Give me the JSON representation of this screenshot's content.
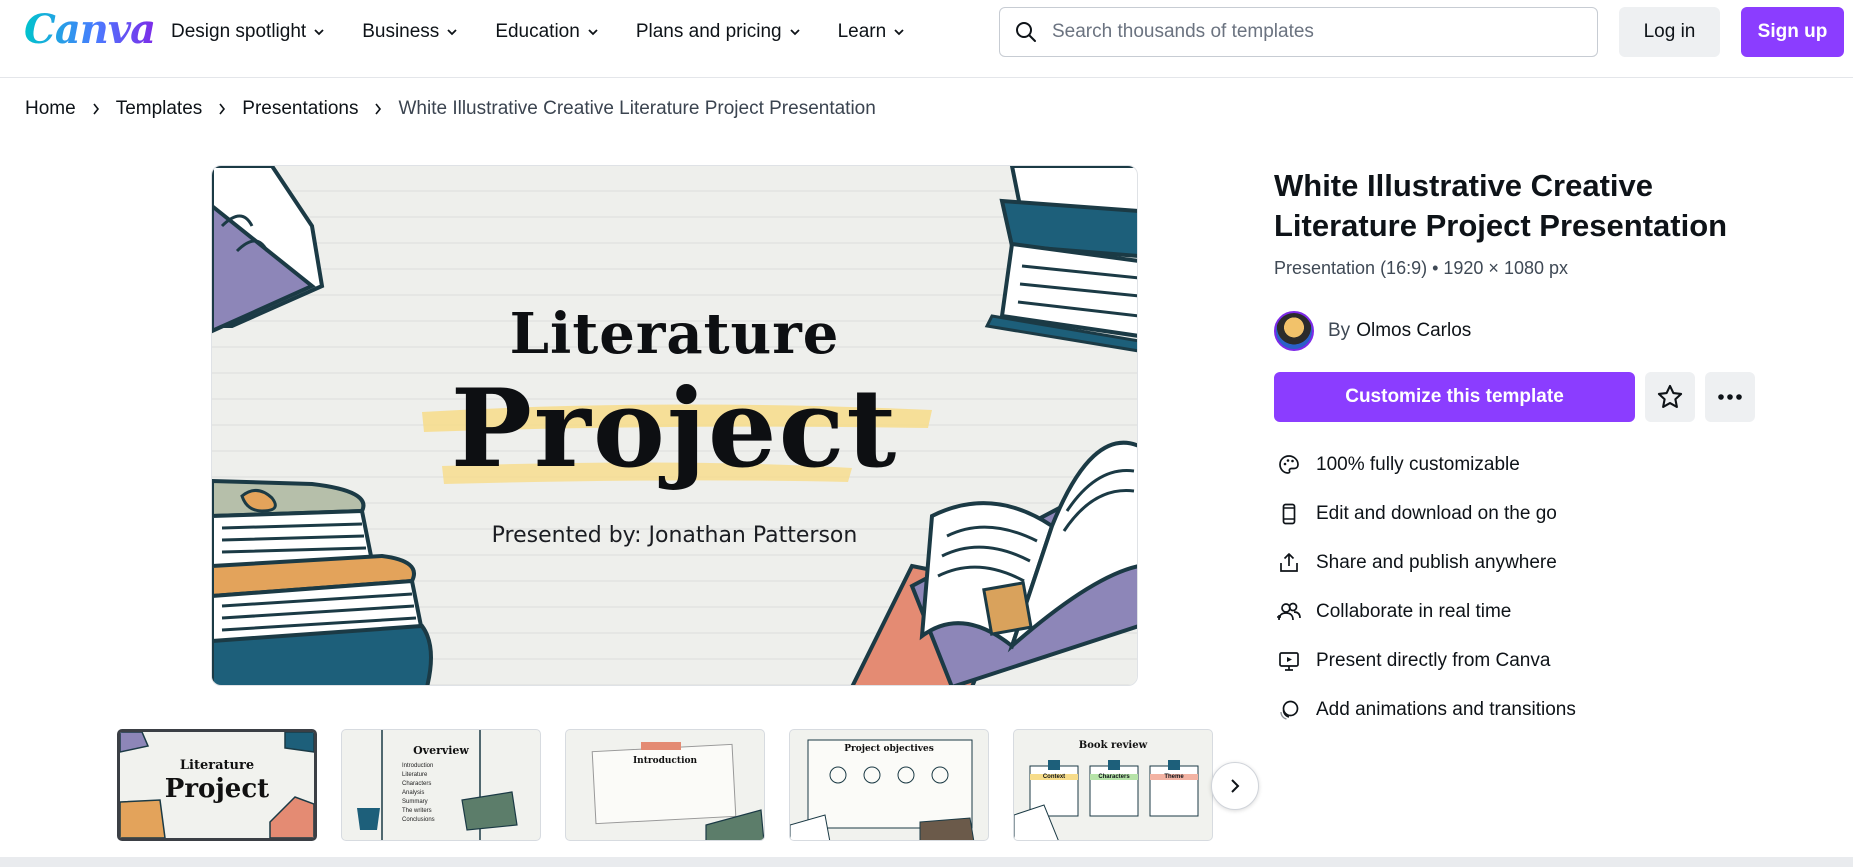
{
  "brand": {
    "logo_text": "Canva",
    "accent": "#8b3dff"
  },
  "nav": {
    "items": [
      {
        "label": "Design spotlight"
      },
      {
        "label": "Business"
      },
      {
        "label": "Education"
      },
      {
        "label": "Plans and pricing"
      },
      {
        "label": "Learn"
      }
    ]
  },
  "search": {
    "placeholder": "Search thousands of templates",
    "icon": "search-icon"
  },
  "auth": {
    "login_label": "Log in",
    "signup_label": "Sign up"
  },
  "breadcrumb": {
    "items": [
      "Home",
      "Templates",
      "Presentations"
    ],
    "current": "White Illustrative Creative Literature Project Presentation"
  },
  "preview": {
    "line1": "Literature",
    "line2": "Project",
    "presented_by": "Presented by: Jonathan Patterson"
  },
  "thumbnails": [
    {
      "title": "Literature",
      "subtitle": "Project"
    },
    {
      "title": "Overview",
      "list": [
        "Introduction",
        "Literature",
        "Characters",
        "Analysis",
        "Summary",
        "The writers",
        "Conclusions"
      ]
    },
    {
      "title": "Introduction"
    },
    {
      "title": "Project objectives"
    },
    {
      "title": "Book review",
      "cards": [
        "Context",
        "Characters",
        "Theme"
      ]
    }
  ],
  "template": {
    "title": "White Illustrative Creative Literature Project Presentation",
    "meta": "Presentation (16:9) • 1920 × 1080 px",
    "by_label": "By",
    "author": "Olmos Carlos",
    "customize_label": "Customize this template"
  },
  "features": [
    {
      "icon": "palette-icon",
      "label": "100% fully customizable"
    },
    {
      "icon": "mobile-icon",
      "label": "Edit and download on the go"
    },
    {
      "icon": "share-icon",
      "label": "Share and publish anywhere"
    },
    {
      "icon": "collaborate-icon",
      "label": "Collaborate in real time"
    },
    {
      "icon": "present-icon",
      "label": "Present directly from Canva"
    },
    {
      "icon": "animation-icon",
      "label": "Add animations and transitions"
    }
  ]
}
